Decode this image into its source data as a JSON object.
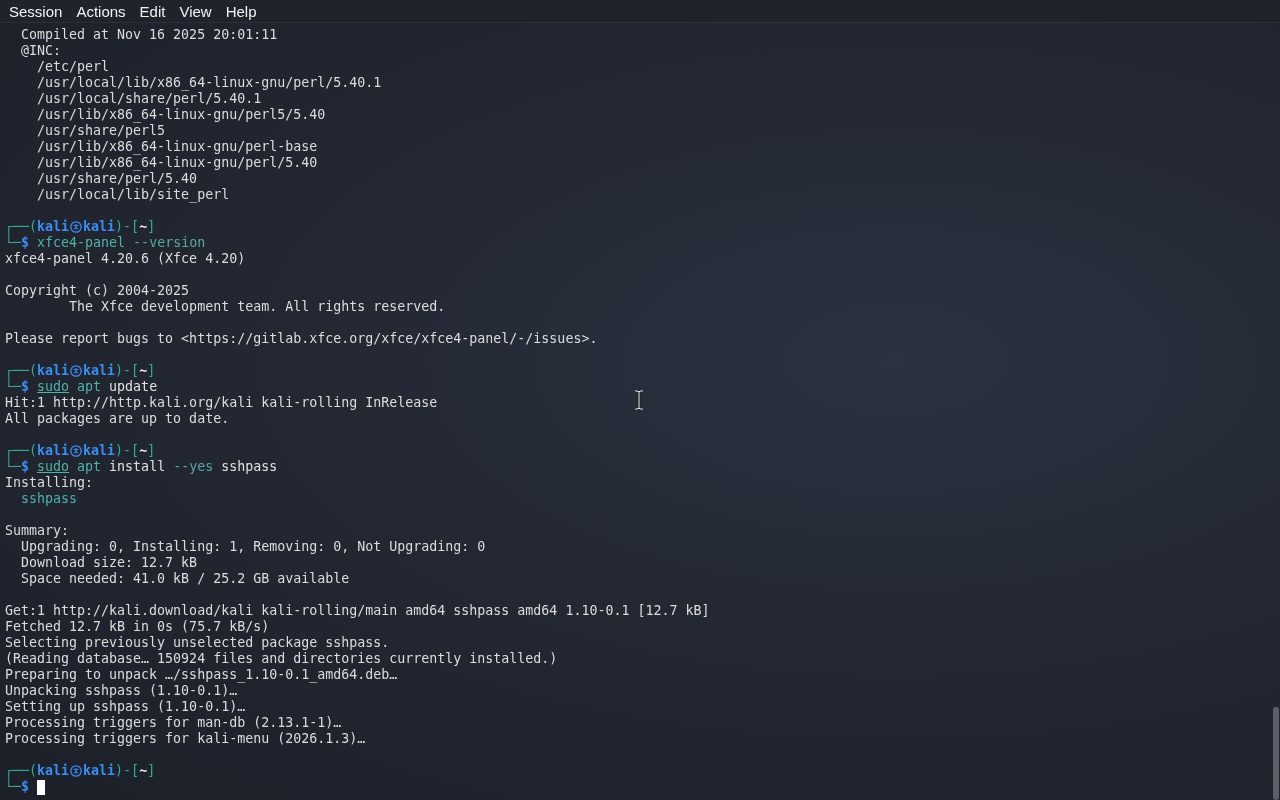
{
  "menu": [
    {
      "label": "Session"
    },
    {
      "label": "Actions"
    },
    {
      "label": "Edit"
    },
    {
      "label": "View"
    },
    {
      "label": "Help"
    }
  ],
  "lines": [
    {
      "kind": "text",
      "text": "  Compiled at Nov 16 2025 20:01:11"
    },
    {
      "kind": "text",
      "text": "  @INC:"
    },
    {
      "kind": "text",
      "text": "    /etc/perl"
    },
    {
      "kind": "text",
      "text": "    /usr/local/lib/x86_64-linux-gnu/perl/5.40.1"
    },
    {
      "kind": "text",
      "text": "    /usr/local/share/perl/5.40.1"
    },
    {
      "kind": "text",
      "text": "    /usr/lib/x86_64-linux-gnu/perl5/5.40"
    },
    {
      "kind": "text",
      "text": "    /usr/share/perl5"
    },
    {
      "kind": "text",
      "text": "    /usr/lib/x86_64-linux-gnu/perl-base"
    },
    {
      "kind": "text",
      "text": "    /usr/lib/x86_64-linux-gnu/perl/5.40"
    },
    {
      "kind": "text",
      "text": "    /usr/share/perl/5.40"
    },
    {
      "kind": "text",
      "text": "    /usr/local/lib/site_perl"
    },
    {
      "kind": "blank"
    },
    {
      "kind": "styled",
      "segments": [
        {
          "kind": "frame",
          "text": "┌──("
        },
        {
          "kind": "user",
          "text": "kali"
        },
        {
          "kind": "at-mark"
        },
        {
          "kind": "user",
          "text": "kali"
        },
        {
          "kind": "frame",
          "text": ")-["
        },
        {
          "kind": "dir",
          "text": "~"
        },
        {
          "kind": "frame",
          "text": "]"
        }
      ]
    },
    {
      "kind": "styled",
      "segments": [
        {
          "kind": "frame",
          "text": "└─"
        },
        {
          "kind": "user",
          "text": "$"
        },
        {
          "kind": "command",
          "text": " xfce4-panel"
        },
        {
          "kind": "option",
          "text": " --version"
        }
      ]
    },
    {
      "kind": "text",
      "text": "xfce4-panel 4.20.6 (Xfce 4.20)"
    },
    {
      "kind": "blank"
    },
    {
      "kind": "text",
      "text": "Copyright (c) 2004-2025"
    },
    {
      "kind": "text",
      "text": "        The Xfce development team. All rights reserved."
    },
    {
      "kind": "blank"
    },
    {
      "kind": "text",
      "text": "Please report bugs to <https://gitlab.xfce.org/xfce/xfce4-panel/-/issues>."
    },
    {
      "kind": "blank"
    },
    {
      "kind": "styled",
      "segments": [
        {
          "kind": "frame",
          "text": "┌──("
        },
        {
          "kind": "user",
          "text": "kali"
        },
        {
          "kind": "at-mark"
        },
        {
          "kind": "user",
          "text": "kali"
        },
        {
          "kind": "frame",
          "text": ")-["
        },
        {
          "kind": "dir",
          "text": "~"
        },
        {
          "kind": "frame",
          "text": "]"
        }
      ]
    },
    {
      "kind": "styled",
      "segments": [
        {
          "kind": "frame",
          "text": "└─"
        },
        {
          "kind": "user",
          "text": "$"
        },
        {
          "kind": "sudo",
          "text": "sudo"
        },
        {
          "kind": "command",
          "text": " apt"
        },
        {
          "kind": "argument",
          "text": " update"
        }
      ]
    },
    {
      "kind": "text",
      "text": "Hit:1 http://http.kali.org/kali kali-rolling InRelease"
    },
    {
      "kind": "text",
      "text": "All packages are up to date."
    },
    {
      "kind": "blank"
    },
    {
      "kind": "styled",
      "segments": [
        {
          "kind": "frame",
          "text": "┌──("
        },
        {
          "kind": "user",
          "text": "kali"
        },
        {
          "kind": "at-mark"
        },
        {
          "kind": "user",
          "text": "kali"
        },
        {
          "kind": "frame",
          "text": ")-["
        },
        {
          "kind": "dir",
          "text": "~"
        },
        {
          "kind": "frame",
          "text": "]"
        }
      ]
    },
    {
      "kind": "styled",
      "segments": [
        {
          "kind": "frame",
          "text": "└─"
        },
        {
          "kind": "user",
          "text": "$"
        },
        {
          "kind": "sudo",
          "text": "sudo"
        },
        {
          "kind": "command",
          "text": " apt"
        },
        {
          "kind": "argument",
          "text": " install"
        },
        {
          "kind": "option",
          "text": " --yes"
        },
        {
          "kind": "argument",
          "text": " sshpass"
        }
      ]
    },
    {
      "kind": "text",
      "text": "Installing:"
    },
    {
      "kind": "styled",
      "segments": [
        {
          "kind": "package",
          "text": "  sshpass"
        }
      ]
    },
    {
      "kind": "blank"
    },
    {
      "kind": "text",
      "text": "Summary:"
    },
    {
      "kind": "text",
      "text": "  Upgrading: 0, Installing: 1, Removing: 0, Not Upgrading: 0"
    },
    {
      "kind": "text",
      "text": "  Download size: 12.7 kB"
    },
    {
      "kind": "text",
      "text": "  Space needed: 41.0 kB / 25.2 GB available"
    },
    {
      "kind": "blank"
    },
    {
      "kind": "text",
      "text": "Get:1 http://kali.download/kali kali-rolling/main amd64 sshpass amd64 1.10-0.1 [12.7 kB]"
    },
    {
      "kind": "text",
      "text": "Fetched 12.7 kB in 0s (75.7 kB/s)"
    },
    {
      "kind": "text",
      "text": "Selecting previously unselected package sshpass."
    },
    {
      "kind": "text",
      "text": "(Reading database… 150924 files and directories currently installed.)"
    },
    {
      "kind": "text",
      "text": "Preparing to unpack …/sshpass_1.10-0.1_amd64.deb…"
    },
    {
      "kind": "text",
      "text": "Unpacking sshpass (1.10-0.1)…"
    },
    {
      "kind": "text",
      "text": "Setting up sshpass (1.10-0.1)…"
    },
    {
      "kind": "text",
      "text": "Processing triggers for man-db (2.13.1-1)…"
    },
    {
      "kind": "text",
      "text": "Processing triggers for kali-menu (2026.1.3)…"
    },
    {
      "kind": "blank"
    },
    {
      "kind": "styled",
      "segments": [
        {
          "kind": "frame",
          "text": "┌──("
        },
        {
          "kind": "user",
          "text": "kali"
        },
        {
          "kind": "at-mark"
        },
        {
          "kind": "user",
          "text": "kali"
        },
        {
          "kind": "frame",
          "text": ")-["
        },
        {
          "kind": "dir",
          "text": "~"
        },
        {
          "kind": "frame",
          "text": "]"
        }
      ]
    },
    {
      "kind": "styled",
      "segments": [
        {
          "kind": "frame",
          "text": "└─"
        },
        {
          "kind": "user",
          "text": "$"
        },
        {
          "kind": "cursor"
        }
      ]
    }
  ]
}
